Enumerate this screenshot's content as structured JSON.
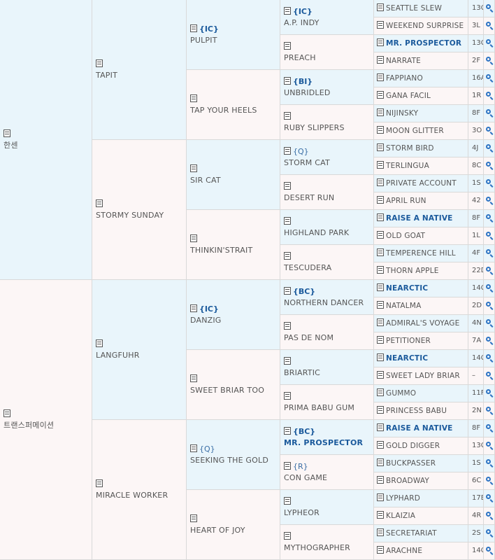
{
  "gen1": [
    {
      "name": "한센"
    },
    {
      "name": "트랜스퍼메이션"
    }
  ],
  "gen2": [
    {
      "name": "TAPIT"
    },
    {
      "name": "STORMY SUNDAY"
    },
    {
      "name": "LANGFUHR"
    },
    {
      "name": "MIRACLE WORKER"
    }
  ],
  "gen3": [
    {
      "tag": "{IC}",
      "name": "PULPIT"
    },
    {
      "name": "TAP YOUR HEELS"
    },
    {
      "name": "SIR CAT"
    },
    {
      "name": "THINKIN'STRAIT"
    },
    {
      "tag": "{IC}",
      "name": "DANZIG"
    },
    {
      "name": "SWEET BRIAR TOO"
    },
    {
      "tag": "{Q}",
      "tag_plain": true,
      "name": "SEEKING THE GOLD"
    },
    {
      "name": "HEART OF JOY"
    }
  ],
  "gen4": [
    {
      "tag": "{IC}",
      "name": "A.P. INDY"
    },
    {
      "name": "PREACH"
    },
    {
      "tag": "{BI}",
      "name": "UNBRIDLED"
    },
    {
      "name": "RUBY SLIPPERS"
    },
    {
      "tag": "{Q}",
      "tag_plain": true,
      "name": "STORM CAT"
    },
    {
      "name": "DESERT RUN"
    },
    {
      "name": "HIGHLAND PARK"
    },
    {
      "name": "TESCUDERA"
    },
    {
      "tag": "{BC}",
      "name": "NORTHERN DANCER"
    },
    {
      "name": "PAS DE NOM"
    },
    {
      "name": "BRIARTIC"
    },
    {
      "name": "PRIMA BABU GUM"
    },
    {
      "tag": "{BC}",
      "name": "MR. PROSPECTOR",
      "bold": true
    },
    {
      "tag": "{R}",
      "tag_plain": true,
      "name": "CON GAME"
    },
    {
      "name": "LYPHEOR"
    },
    {
      "name": "MYTHOGRAPHER"
    }
  ],
  "gen5": [
    {
      "name": "SEATTLE SLEW",
      "count": "13C"
    },
    {
      "name": "WEEKEND SURPRISE",
      "count": "3L"
    },
    {
      "name": "MR. PROSPECTOR",
      "bold": true,
      "count": "13C"
    },
    {
      "name": "NARRATE",
      "count": "2F"
    },
    {
      "name": "FAPPIANO",
      "count": "16A"
    },
    {
      "name": "GANA FACIL",
      "count": "1R"
    },
    {
      "name": "NIJINSKY",
      "count": "8F"
    },
    {
      "name": "MOON GLITTER",
      "count": "3O"
    },
    {
      "name": "STORM BIRD",
      "count": "4J"
    },
    {
      "name": "TERLINGUA",
      "count": "8C"
    },
    {
      "name": "PRIVATE ACCOUNT",
      "count": "1S"
    },
    {
      "name": "APRIL RUN",
      "count": "42"
    },
    {
      "name": "RAISE A NATIVE",
      "bold": true,
      "count": "8F"
    },
    {
      "name": "OLD GOAT",
      "count": "1L"
    },
    {
      "name": "TEMPERENCE HILL",
      "count": "4F"
    },
    {
      "name": "THORN APPLE",
      "count": "22D"
    },
    {
      "name": "NEARCTIC",
      "bold": true,
      "count": "14C"
    },
    {
      "name": "NATALMA",
      "count": "2D"
    },
    {
      "name": "ADMIRAL'S VOYAGE",
      "count": "4N"
    },
    {
      "name": "PETITIONER",
      "count": "7A"
    },
    {
      "name": "NEARCTIC",
      "bold": true,
      "count": "14C"
    },
    {
      "name": "SWEET LADY BRIAR",
      "count": "–"
    },
    {
      "name": "GUMMO",
      "count": "11F"
    },
    {
      "name": "PRINCESS BABU",
      "count": "2N"
    },
    {
      "name": "RAISE A NATIVE",
      "bold": true,
      "count": "8F"
    },
    {
      "name": "GOLD DIGGER",
      "count": "13C"
    },
    {
      "name": "BUCKPASSER",
      "count": "1S"
    },
    {
      "name": "BROADWAY",
      "count": "6C"
    },
    {
      "name": "LYPHARD",
      "count": "17B"
    },
    {
      "name": "KLAIZIA",
      "count": "4R"
    },
    {
      "name": "SECRETARIAT",
      "count": "2S"
    },
    {
      "name": "ARACHNE",
      "count": "14C"
    }
  ],
  "icons": {
    "doc": "document-icon",
    "search": "magnifier-icon"
  },
  "colors": {
    "male_bg": "#e9f5fb",
    "female_bg": "#fcf6f6",
    "tag": "#1b5a9c",
    "search": "#2d74c4"
  }
}
